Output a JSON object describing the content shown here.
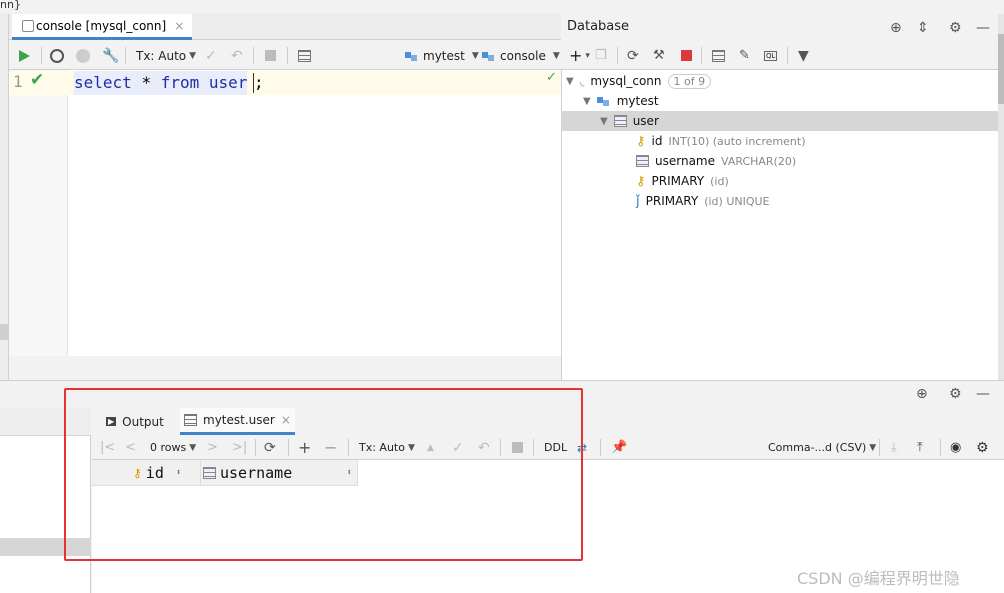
{
  "corner": {
    "label": "nn}"
  },
  "editor": {
    "tab_label": "console [mysql_conn]",
    "tab_close": "×",
    "toolbar": {
      "tx_label": "Tx: Auto",
      "schema_label": "mytest",
      "session_label": "console"
    },
    "line_number": "1",
    "code": {
      "kw1": "select",
      "star": "*",
      "kw2": "from",
      "table": "user",
      "tail": ";"
    }
  },
  "database": {
    "title": "Database",
    "tree": [
      {
        "label": "mysql_conn",
        "badge": "1 of 9"
      },
      {
        "label": "mytest"
      },
      {
        "label": "user"
      },
      {
        "label": "id",
        "meta": "INT(10) (auto increment)"
      },
      {
        "label": "username",
        "meta": "VARCHAR(20)"
      },
      {
        "label": "PRIMARY",
        "meta": "(id)"
      },
      {
        "label": "PRIMARY",
        "meta": "(id) UNIQUE"
      }
    ]
  },
  "results": {
    "tabs": [
      {
        "label": "Output"
      },
      {
        "label": "mytest.user",
        "close": "×"
      }
    ],
    "toolbar": {
      "rows_label": "0 rows",
      "tx_label": "Tx: Auto",
      "ddl_label": "DDL",
      "export_label": "Comma-...d (CSV)"
    },
    "columns": [
      "id",
      "username"
    ]
  },
  "watermark": "CSDN @编程界明世隐",
  "colors": {
    "accent": "#4083c9",
    "annotation": "#e53232",
    "run": "#3fa34d"
  }
}
